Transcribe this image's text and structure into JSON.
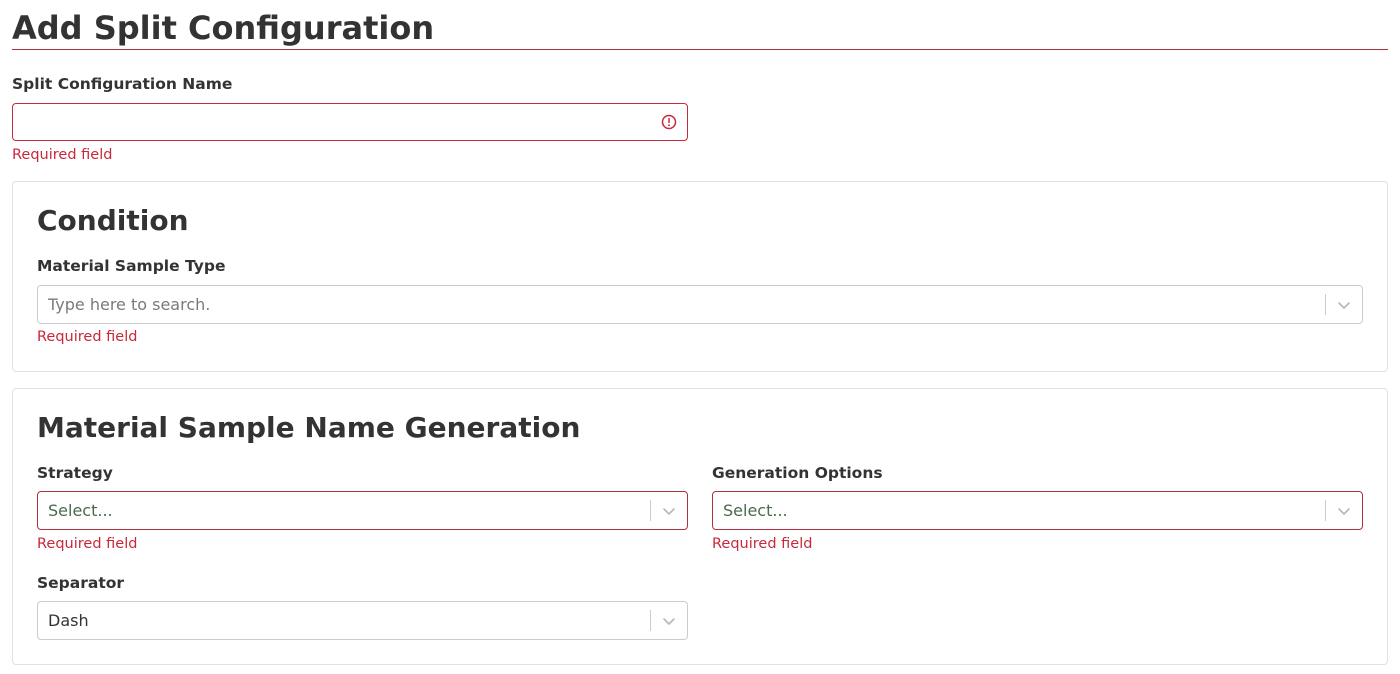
{
  "page": {
    "title": "Add Split Configuration"
  },
  "name_field": {
    "label": "Split Configuration Name",
    "value": "",
    "error": "Required field"
  },
  "condition": {
    "title": "Condition",
    "material_sample_type": {
      "label": "Material Sample Type",
      "placeholder": "Type here to search.",
      "error": "Required field"
    }
  },
  "name_generation": {
    "title": "Material Sample Name Generation",
    "strategy": {
      "label": "Strategy",
      "placeholder": "Select...",
      "error": "Required field"
    },
    "generation_options": {
      "label": "Generation Options",
      "placeholder": "Select...",
      "error": "Required field"
    },
    "separator": {
      "label": "Separator",
      "value": "Dash"
    }
  },
  "icons": {
    "error": "exclamation-circle-icon",
    "dropdown": "chevron-down-icon"
  },
  "colors": {
    "accent": "#b0313f",
    "error": "#c8283a",
    "border": "#cccccc",
    "card_border": "#dfe1e4",
    "text": "#333333"
  }
}
